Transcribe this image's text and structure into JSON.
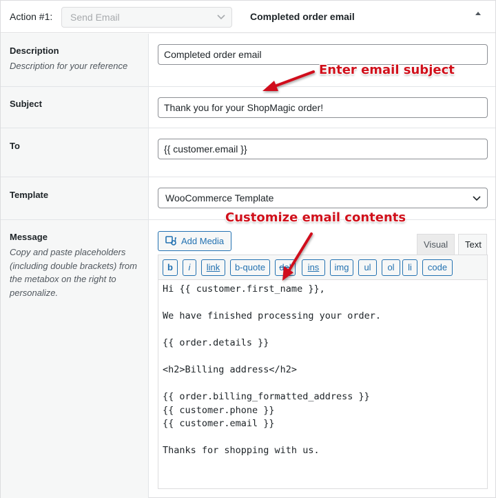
{
  "header": {
    "action_label": "Action #1:",
    "action_select_value": "Send Email",
    "title": "Completed order email"
  },
  "rows": {
    "description": {
      "label": "Description",
      "help": "Description for your reference",
      "value": "Completed order email"
    },
    "subject": {
      "label": "Subject",
      "value": "Thank you for your ShopMagic order!"
    },
    "to": {
      "label": "To",
      "value": "{{ customer.email }}"
    },
    "template": {
      "label": "Template",
      "value": "WooCommerce Template"
    },
    "message": {
      "label": "Message",
      "help": "Copy and paste placeholders (including double brackets) from the metabox on the right to personalize."
    }
  },
  "editor": {
    "add_media_label": "Add Media",
    "tabs": [
      "Visual",
      "Text"
    ],
    "active_tab": "Text",
    "quicktags": [
      "b",
      "i",
      "link",
      "b-quote",
      "del",
      "ins",
      "img",
      "ul",
      "ol",
      "li",
      "code"
    ],
    "content": "Hi {{ customer.first_name }},\n\nWe have finished processing your order.\n\n{{ order.details }}\n\n<h2>Billing address</h2>\n\n{{ order.billing_formatted_address }}\n{{ customer.phone }}\n{{ customer.email }}\n\nThanks for shopping with us."
  },
  "annotations": {
    "subject_callout": "Enter email subject",
    "message_callout": "Customize email contents",
    "color": "#d0101b"
  },
  "colors": {
    "accent": "#2271b1",
    "label_bg": "#f6f7f7",
    "border": "#dcdcde"
  }
}
